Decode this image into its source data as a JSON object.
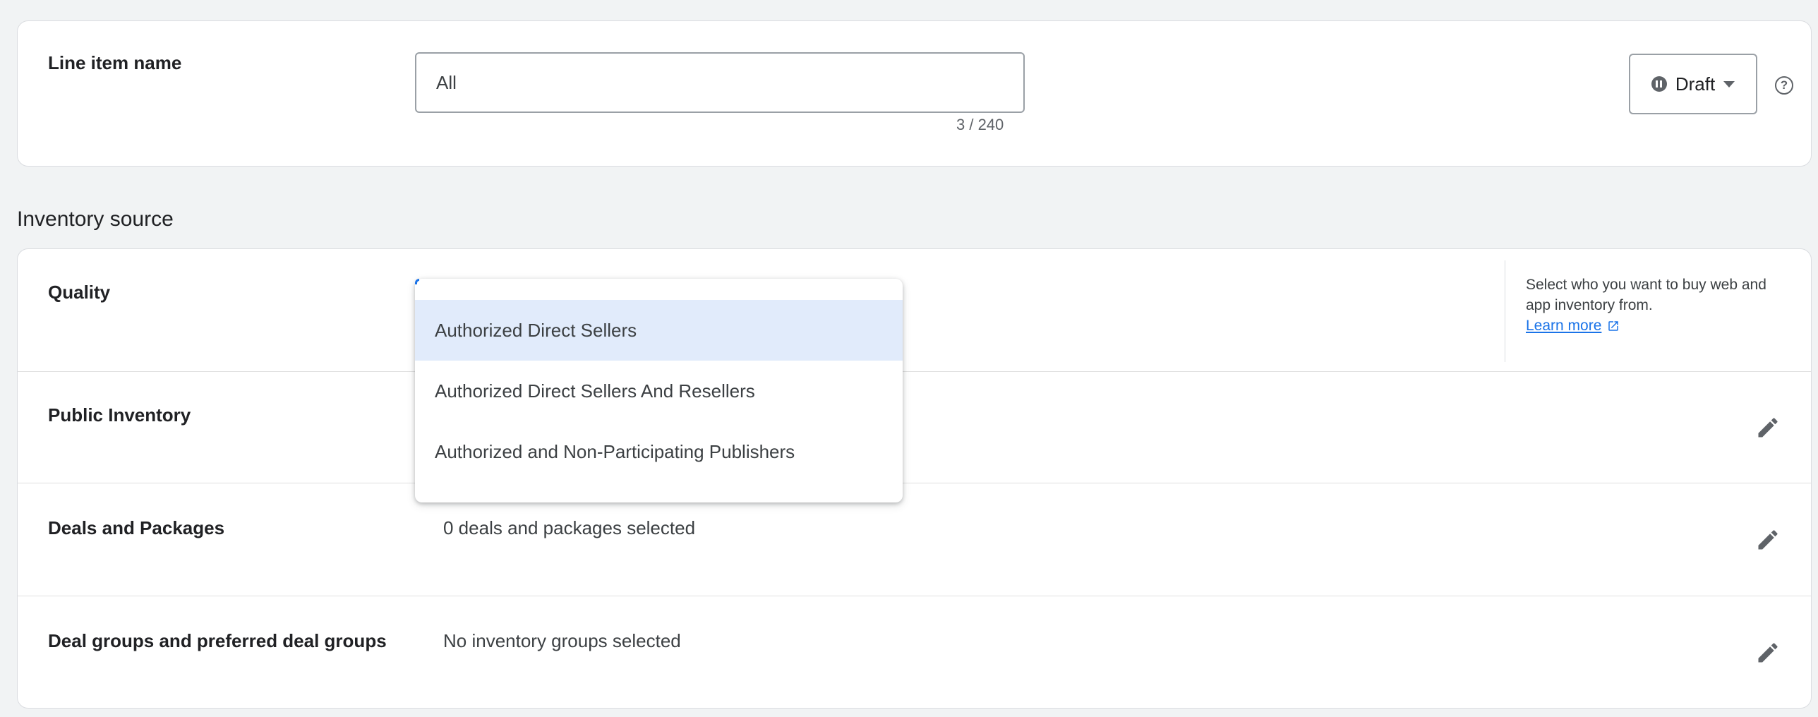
{
  "line_item": {
    "label": "Line item name",
    "value": "All",
    "counter": "3 / 240",
    "status": "Draft"
  },
  "inventory_source": {
    "title": "Inventory source",
    "quality": {
      "label": "Quality",
      "help_text": "Select who you want to buy web and app inventory from.",
      "learn_more": "Learn more",
      "options": [
        "Authorized Direct Sellers",
        "Authorized Direct Sellers And Resellers",
        "Authorized and Non-Participating Publishers"
      ],
      "highlighted_option": "Authorized Direct Sellers"
    },
    "public_inventory": {
      "label": "Public Inventory"
    },
    "deals": {
      "label": "Deals and Packages",
      "value": "0 deals and packages selected"
    },
    "deal_groups": {
      "label": "Deal groups and preferred deal groups",
      "value": "No inventory groups selected"
    }
  },
  "icons": {
    "status": "pause-circle-icon",
    "dropdown": "caret-down-icon",
    "help": "help-circle-icon",
    "external": "open-in-new-icon",
    "edit": "pencil-icon"
  },
  "colors": {
    "accent": "#1a73e8",
    "highlight": "#e1ebfb",
    "background": "#f1f3f4"
  }
}
